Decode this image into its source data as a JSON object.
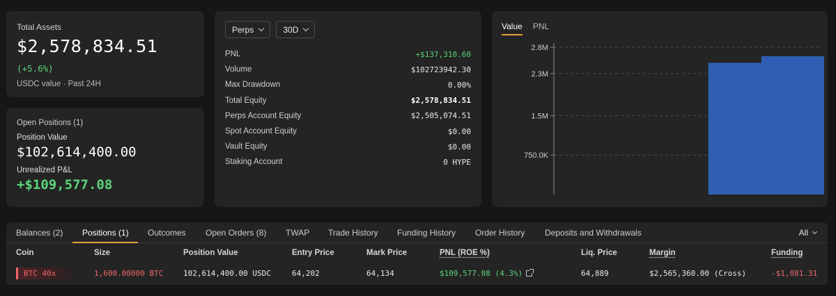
{
  "assets": {
    "label": "Total Assets",
    "value": "$2,578,834.51",
    "change": "(+5.6%)",
    "sub": "USDC value · Past 24H"
  },
  "open_positions": {
    "title": "Open Positions (1)",
    "position_value_label": "Position Value",
    "position_value": "$102,614,400.00",
    "unrealized_label": "Unrealized P&L",
    "unrealized_value": "+$109,577.08"
  },
  "stats": {
    "market_dropdown": "Perps",
    "period_dropdown": "30D",
    "rows": [
      {
        "label": "PNL",
        "value": "+$137,310.60",
        "style": "green"
      },
      {
        "label": "Volume",
        "value": "$102723942.30",
        "style": ""
      },
      {
        "label": "Max Drawdown",
        "value": "0.00%",
        "style": ""
      },
      {
        "label": "Total Equity",
        "value": "$2,578,834.51",
        "style": "bold"
      },
      {
        "label": "Perps Account Equity",
        "value": "$2,505,074.51",
        "style": ""
      },
      {
        "label": "Spot Account Equity",
        "value": "$0.00",
        "style": ""
      },
      {
        "label": "Vault Equity",
        "value": "$0.00",
        "style": ""
      },
      {
        "label": "Staking Account",
        "value": "0 HYPE",
        "style": ""
      }
    ]
  },
  "chart_tabs": [
    "Value",
    "PNL"
  ],
  "chart_data": {
    "type": "bar",
    "title": "",
    "xlabel": "",
    "ylabel": "",
    "y_tick_labels": [
      "2.8M",
      "2.3M",
      "1.5M",
      "750.0K"
    ],
    "y_ticks": [
      2800000,
      2300000,
      1500000,
      750000
    ],
    "ylim": [
      0,
      2800000
    ],
    "categories": [
      "",
      "",
      "",
      "",
      ""
    ],
    "values": [
      0,
      0,
      0,
      2505074.51,
      2630000
    ],
    "grid": true,
    "bar_color": "#2f5fb3"
  },
  "tabs": {
    "items": [
      "Balances (2)",
      "Positions (1)",
      "Outcomes",
      "Open Orders (8)",
      "TWAP",
      "Trade History",
      "Funding History",
      "Order History",
      "Deposits and Withdrawals"
    ],
    "active_index": 1,
    "filter": "All"
  },
  "positions_table": {
    "headers": [
      "Coin",
      "Size",
      "Position Value",
      "Entry Price",
      "Mark Price",
      "PNL (ROE %)",
      "Liq. Price",
      "Margin",
      "Funding"
    ],
    "rows": [
      {
        "coin": "BTC 40x",
        "size": "1,600.00000 BTC",
        "position_value": "102,614,400.00 USDC",
        "entry_price": "64,202",
        "mark_price": "64,134",
        "pnl": "$109,577.08 (4.3%)",
        "liq_price": "64,889",
        "margin": "$2,565,360.00 (Cross)",
        "funding": "-$1,081.31"
      }
    ]
  },
  "colors": {
    "accent": "#e8a33d",
    "positive": "#5bd57a",
    "negative": "#f0676a",
    "bar": "#2f5fb3"
  }
}
